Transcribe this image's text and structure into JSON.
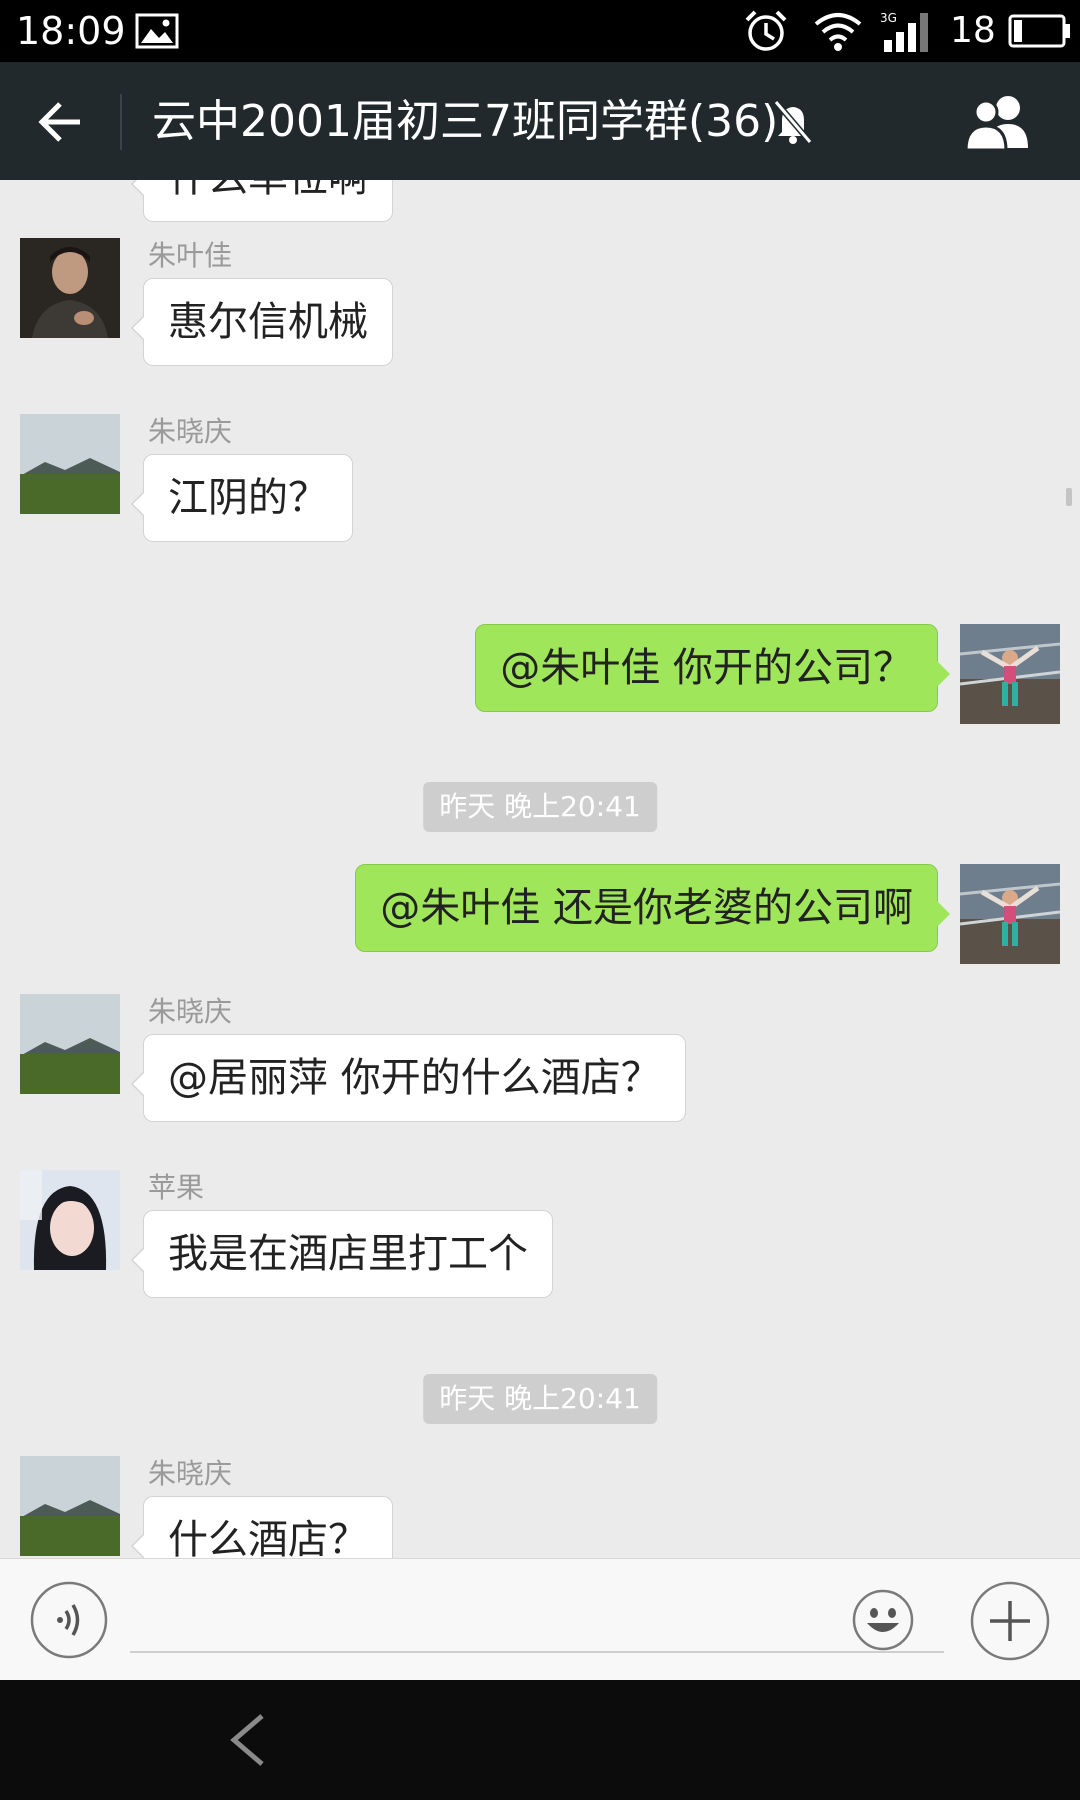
{
  "status_bar": {
    "time": "18:09",
    "battery_level": "18",
    "icons": [
      "gallery-icon",
      "alarm-icon",
      "wifi-icon",
      "signal-3g-icon",
      "battery-icon"
    ]
  },
  "header": {
    "title": "云中2001届初三7班同学群(36)",
    "icons": [
      "back-arrow-icon",
      "mute-bell-icon",
      "group-members-icon"
    ]
  },
  "messages": [
    {
      "direction": "in",
      "sender": "",
      "text": "什么单位啊"
    },
    {
      "direction": "in",
      "sender": "朱叶佳",
      "text": "惠尔信机械"
    },
    {
      "direction": "in",
      "sender": "朱晓庆",
      "text": "江阴的？"
    },
    {
      "direction": "out",
      "sender": "",
      "text": "@朱叶佳 你开的公司？"
    },
    {
      "type": "timestamp",
      "text": "昨天 晚上20:41"
    },
    {
      "direction": "out",
      "sender": "",
      "text": "@朱叶佳 还是你老婆的公司啊"
    },
    {
      "direction": "in",
      "sender": "朱晓庆",
      "text": "@居丽萍 你开的什么酒店？"
    },
    {
      "direction": "in",
      "sender": "苹果",
      "text": "我是在酒店里打工个"
    },
    {
      "type": "timestamp",
      "text": "昨天 晚上20:41"
    },
    {
      "direction": "in",
      "sender": "朱晓庆",
      "text": "什么酒店？"
    }
  ],
  "input_bar": {
    "value": "",
    "icons": [
      "voice-icon",
      "emoji-icon",
      "plus-icon"
    ]
  },
  "nav_bar": {
    "icons": [
      "nav-back-icon"
    ]
  },
  "colors": {
    "status_bar": "#000000",
    "title_bar": "#21292c",
    "chat_background": "#ebebeb",
    "outgoing_bubble": "#9fe65a",
    "incoming_bubble": "#ffffff",
    "timestamp_bg": "#cecece",
    "nav_bar": "#0c0c0c"
  }
}
